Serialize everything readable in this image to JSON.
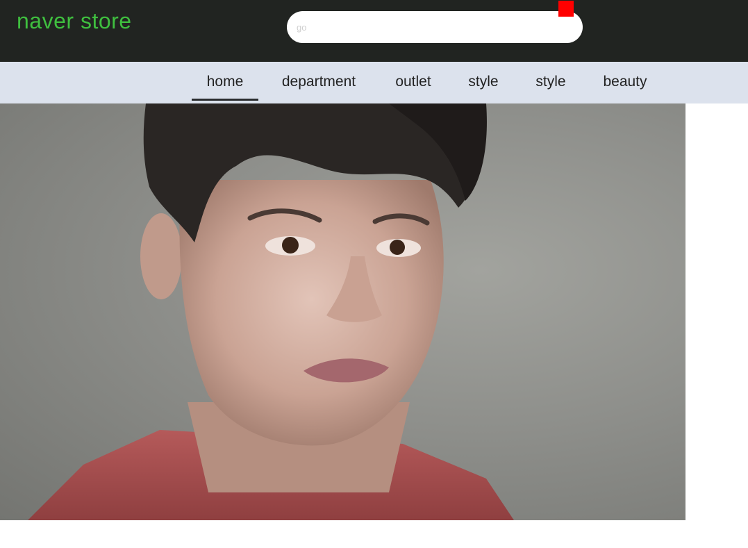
{
  "header": {
    "logo_text": "naver store",
    "logo_color": "#3fbf3f",
    "background_color": "#212421"
  },
  "search": {
    "placeholder": "go",
    "value": "",
    "button_icon": "red-square-icon",
    "button_color": "#ff0000"
  },
  "nav": {
    "background_color": "#dce2ed",
    "items": [
      {
        "label": "home",
        "active": true
      },
      {
        "label": "department",
        "active": false
      },
      {
        "label": "outlet",
        "active": false
      },
      {
        "label": "style",
        "active": false
      },
      {
        "label": "style",
        "active": false
      },
      {
        "label": "beauty",
        "active": false
      }
    ]
  },
  "hero": {
    "subject": "portrait-photo"
  }
}
